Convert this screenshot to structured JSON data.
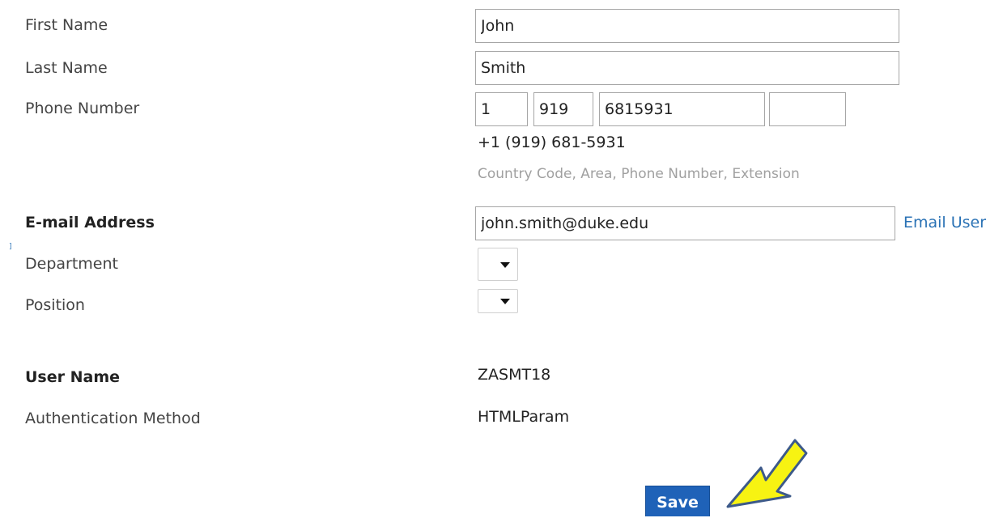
{
  "form": {
    "first_name": {
      "label": "First Name",
      "value": "John"
    },
    "last_name": {
      "label": "Last Name",
      "value": "Smith"
    },
    "phone": {
      "label": "Phone Number",
      "country_code": "1",
      "area": "919",
      "number": "6815931",
      "extension": "",
      "formatted": "+1 (919) 681-5931",
      "hint": "Country Code, Area, Phone Number, Extension"
    },
    "email": {
      "label": "E-mail Address",
      "value": "john.smith@duke.edu",
      "action_label": "Email User"
    },
    "department": {
      "label": "Department",
      "value": ""
    },
    "position": {
      "label": "Position",
      "value": ""
    },
    "user_name": {
      "label": "User Name",
      "value": "ZASMT18"
    },
    "auth_method": {
      "label": "Authentication Method",
      "value": "HTMLParam"
    },
    "save_label": "Save",
    "left_marker": "]"
  },
  "colors": {
    "link": "#2a72b5",
    "save_button": "#1f62b8",
    "hint_text": "#a0a0a0",
    "highlight_arrow": "#f7f312"
  },
  "icons": {
    "dropdown": "caret-down-icon",
    "annotation": "callout-arrow-icon"
  }
}
